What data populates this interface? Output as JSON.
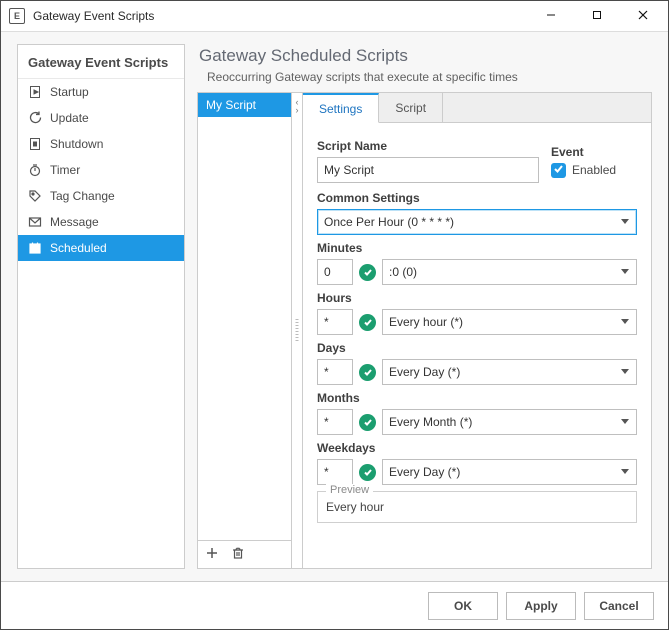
{
  "window": {
    "title": "Gateway Event Scripts"
  },
  "sidebar": {
    "title": "Gateway Event Scripts",
    "items": [
      {
        "label": "Startup",
        "icon": "play-doc-icon",
        "selected": false
      },
      {
        "label": "Update",
        "icon": "refresh-icon",
        "selected": false
      },
      {
        "label": "Shutdown",
        "icon": "stop-doc-icon",
        "selected": false
      },
      {
        "label": "Timer",
        "icon": "stopwatch-icon",
        "selected": false
      },
      {
        "label": "Tag Change",
        "icon": "tag-icon",
        "selected": false
      },
      {
        "label": "Message",
        "icon": "envelope-icon",
        "selected": false
      },
      {
        "label": "Scheduled",
        "icon": "calendar-icon",
        "selected": true
      }
    ]
  },
  "page": {
    "title": "Gateway Scheduled Scripts",
    "subtitle": "Reoccurring Gateway scripts that execute at specific times"
  },
  "script_list": {
    "items": [
      {
        "name": "My Script",
        "selected": true
      }
    ]
  },
  "tabs": {
    "items": [
      {
        "label": "Settings",
        "active": true
      },
      {
        "label": "Script",
        "active": false
      }
    ]
  },
  "form": {
    "script_name_label": "Script Name",
    "event_label": "Event",
    "script_name_value": "My Script",
    "enabled_label": "Enabled",
    "enabled_checked": true,
    "common_label": "Common Settings",
    "common_value": "Once Per Hour (0 * * * *)",
    "minutes_label": "Minutes",
    "minutes_value": "0",
    "minutes_select": ":0 (0)",
    "hours_label": "Hours",
    "hours_value": "*",
    "hours_select": "Every hour (*)",
    "days_label": "Days",
    "days_value": "*",
    "days_select": "Every Day (*)",
    "months_label": "Months",
    "months_value": "*",
    "months_select": "Every Month (*)",
    "weekdays_label": "Weekdays",
    "weekdays_value": "*",
    "weekdays_select": "Every Day (*)",
    "preview_label": "Preview",
    "preview_text": "Every hour"
  },
  "footer": {
    "ok": "OK",
    "apply": "Apply",
    "cancel": "Cancel"
  }
}
